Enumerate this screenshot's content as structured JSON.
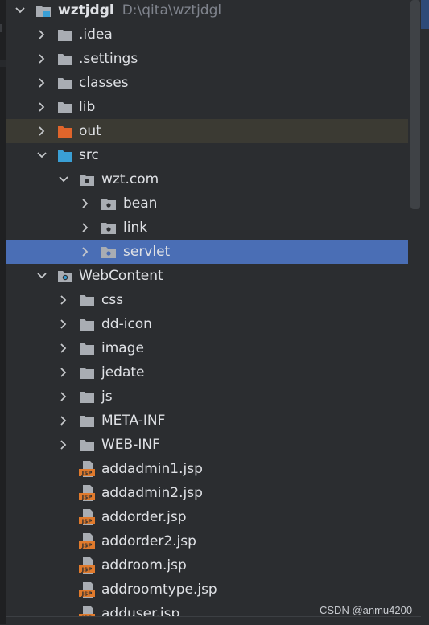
{
  "project": {
    "name": "wztjdgl",
    "path": "D:\\qita\\wztjdgl"
  },
  "tree": {
    "idea": ".idea",
    "settings": ".settings",
    "classes": "classes",
    "lib": "lib",
    "out": "out",
    "src": "src",
    "wzt_com": "wzt.com",
    "bean": "bean",
    "link": "link",
    "servlet": "servlet",
    "webcontent": "WebContent",
    "css": "css",
    "dd_icon": "dd-icon",
    "image": "image",
    "jedate": "jedate",
    "js": "js",
    "meta_inf": "META-INF",
    "web_inf": "WEB-INF",
    "files": [
      "addadmin1.jsp",
      "addadmin2.jsp",
      "addorder.jsp",
      "addorder2.jsp",
      "addroom.jsp",
      "addroomtype.jsp",
      "adduser.jsp"
    ]
  },
  "jsp_badge": "JSP",
  "watermark": "CSDN @anmu4200",
  "colors": {
    "background": "#2b2d30",
    "selection": "#4a6eb5",
    "folder": "#a9adb3",
    "excluded_folder": "#e0652b",
    "source_folder": "#3a9fd5",
    "jsp_icon": "#e07a2c"
  }
}
